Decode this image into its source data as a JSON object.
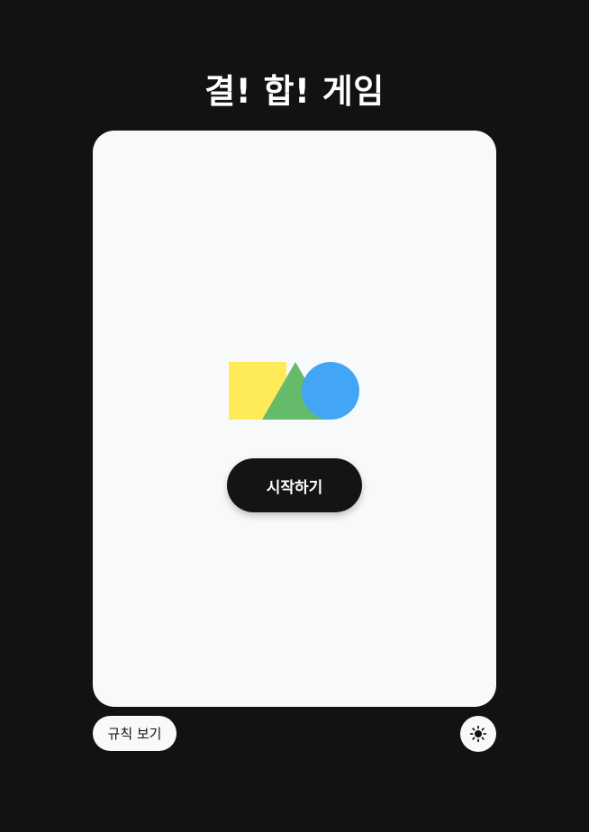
{
  "title": "결! 합! 게임",
  "logo": {
    "icon": "shapes-logo-icon",
    "square_color": "#FFEB57",
    "triangle_color": "#66BB6A",
    "circle_color": "#42A5F5"
  },
  "start_button": {
    "label": "시작하기"
  },
  "rules_button": {
    "label": "규칙 보기"
  },
  "theme_toggle": {
    "icon": "sun-icon"
  },
  "colors": {
    "background": "#121212",
    "card": "#F8F9FB",
    "button_dark": "#141414",
    "text_light": "#FFFFFF"
  }
}
